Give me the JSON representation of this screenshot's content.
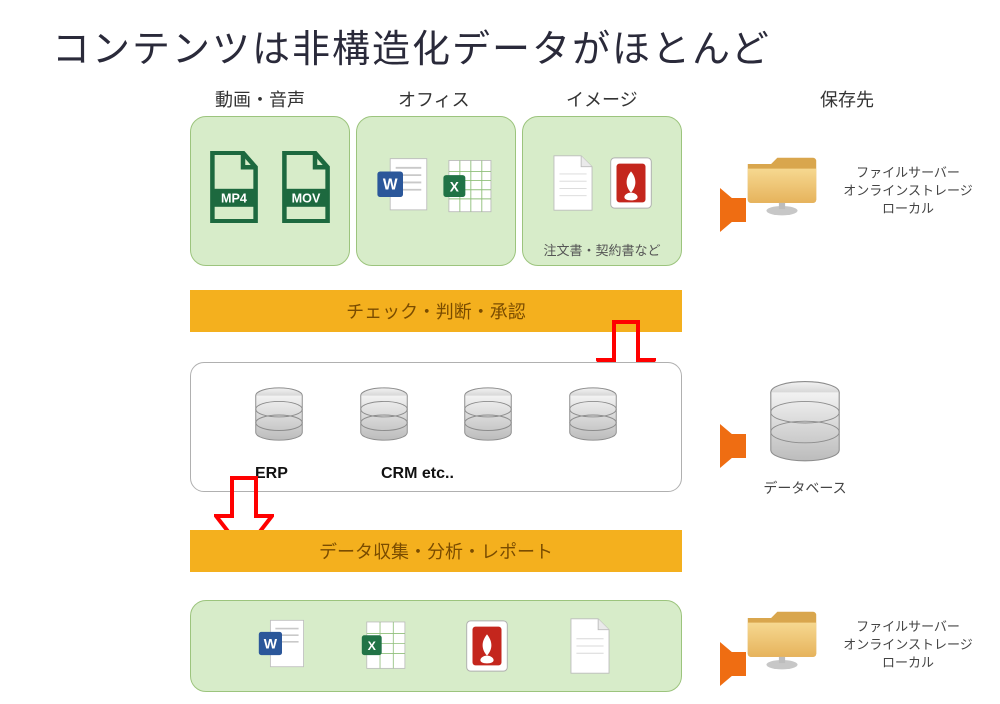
{
  "title": "コンテンツは非構造化データがほとんど",
  "columns": {
    "media": "動画・音声",
    "office": "オフィス",
    "image": "イメージ",
    "destination": "保存先"
  },
  "panel_c_caption": "注文書・契約書など",
  "band1": "チェック・判断・承認",
  "db_labels": {
    "erp": "ERP",
    "crm": "CRM  etc.."
  },
  "band2": "データ収集・分析・レポート",
  "storage_lines": {
    "line1": "ファイルサーバー",
    "line2": "オンラインストレージ",
    "line3": "ローカル"
  },
  "database_label": "データベース",
  "icons": {
    "mp4": "MP4",
    "mov": "MOV"
  }
}
